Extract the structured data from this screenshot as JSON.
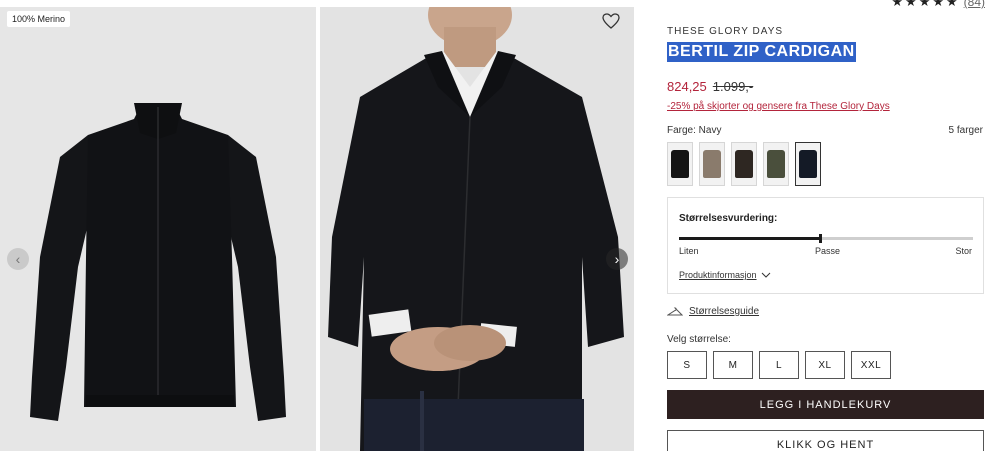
{
  "gallery": {
    "badge": "100% Merino",
    "prev_icon": "‹",
    "next_icon": "›"
  },
  "product": {
    "rating_count": "(84)",
    "rating_stars": 5,
    "brand": "THESE GLORY DAYS",
    "title": "BERTIL ZIP CARDIGAN",
    "price_now": "824,25",
    "price_old": "1.099,-",
    "promo": "-25% på skjorter og gensere fra These Glory Days",
    "color_label": "Farge: Navy",
    "color_count": "5 farger",
    "swatches": [
      {
        "name": "black",
        "color": "#141414"
      },
      {
        "name": "taupe",
        "color": "#8a7b6c"
      },
      {
        "name": "dark-brown",
        "color": "#2e2722"
      },
      {
        "name": "olive",
        "color": "#4a4f3c"
      },
      {
        "name": "navy",
        "color": "#141a26",
        "selected": true
      }
    ]
  },
  "size_rating": {
    "title": "Størrelsesvurdering:",
    "value": 0.48,
    "labels": [
      "Liten",
      "Passe",
      "Stor"
    ],
    "product_info": "Produktinformasjon"
  },
  "size_guide": "Størrelsesguide",
  "choose_size": "Velg størrelse:",
  "sizes": [
    "S",
    "M",
    "L",
    "XL",
    "XXL"
  ],
  "buttons": {
    "add_to_cart": "LEGG I HANDLEKURV",
    "click_collect": "KLIKK OG HENT"
  },
  "colors": {
    "sale": "#b3243b",
    "cart_button": "#2d2020",
    "title_highlight": "#2f61c7"
  }
}
